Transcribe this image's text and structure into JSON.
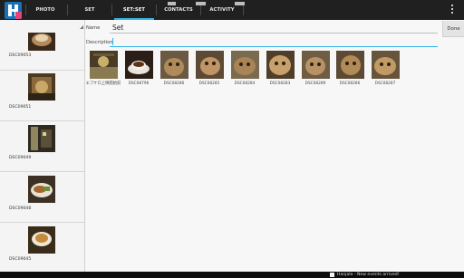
{
  "topbar": {
    "tabs": [
      {
        "label": "PHOTO STREAM"
      },
      {
        "label": "SET"
      },
      {
        "label": "SET:SET",
        "active": true
      },
      {
        "label": "CONTACTS"
      },
      {
        "label": "ACTIVITY"
      }
    ],
    "accent_color": "#33b5e5",
    "logo_colors": [
      "#1b6fb3",
      "#e0457b"
    ]
  },
  "sidebar": {
    "items": [
      {
        "caption": "DSC09053"
      },
      {
        "caption": "DSC09051"
      },
      {
        "caption": "DSC09049"
      },
      {
        "caption": "DSC09048"
      },
      {
        "caption": "DSC09045"
      }
    ]
  },
  "form": {
    "name_label": "Name",
    "name_value": "Set",
    "description_label": "Description",
    "description_value": "",
    "done_label": "Done"
  },
  "photos": [
    {
      "caption": "エフケロ上映開始前"
    },
    {
      "caption": "DSC08796"
    },
    {
      "caption": "DSC08286"
    },
    {
      "caption": "DSC08285"
    },
    {
      "caption": "DSC08284"
    },
    {
      "caption": "DSC08283"
    },
    {
      "caption": "DSC08289"
    },
    {
      "caption": "DSC08286"
    },
    {
      "caption": "DSC08287"
    }
  ],
  "notification": {
    "text": "Hanjala - New events arrived!"
  }
}
